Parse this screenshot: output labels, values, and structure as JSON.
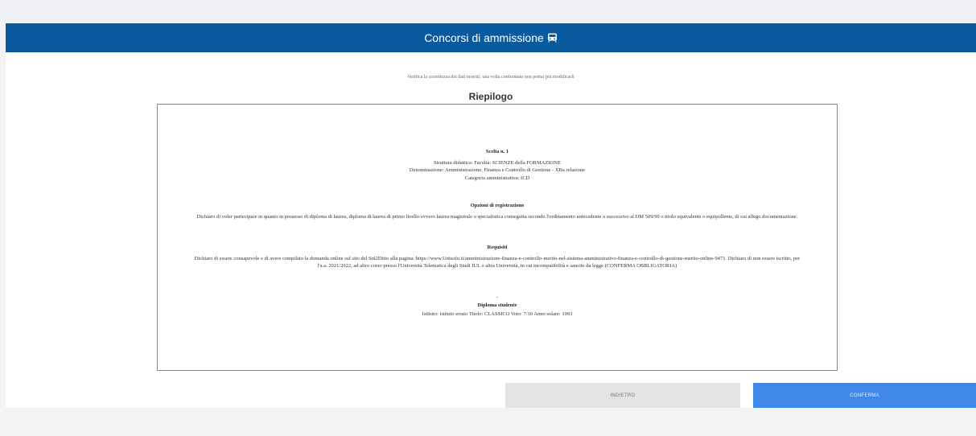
{
  "header": {
    "title": "Concorsi di ammissione",
    "icon": "train-icon"
  },
  "notice": "Verifica la correttezza dei dati inseriti, una volta confermato non potrai più modificarli",
  "summary_title": "Riepilogo",
  "sections": {
    "choice": {
      "heading": "Scelta n. 1",
      "lines": [
        "Struttura didattica: Facoltà: SCIENZE della FORMAZIONE",
        "Denominazione: Amministrazione, Finanza e Controllo di Gestione - XBa relazione",
        "Categoria amministrativa: ICD"
      ]
    },
    "options": {
      "heading": "Opzioni di registrazione",
      "text": "Dichiaro di voler partecipare in quanto in possesso di diploma di laurea, diploma di laurea di primo livello ovvero laurea magistrale o specialistica conseguita secondo l'ordinamento antecedente o successivo al DM 509/99 o titolo equivalente o equipollente, di cui allego documentazione."
    },
    "requirements": {
      "heading": "Requisiti",
      "text": "Dichiaro di essere consapevole e di avere compilato la domanda online sul sito del Sol2Ditto alla pagina: https://www.Unisofu.it/amministrazione-finanza-e-controllo-merito-nel-sistema-amministrativo-finanza-e-controllo-di-gestione-merito-online-9471. Dichiaro di non essere iscritto, per l'a.a. 2021/2022, ad altro corso presso l'Università Telematica degli Studi IUL o altra Università, in cui incompatibilità e sancite da legge (CONFERMA OBBLIGATORIA)"
    },
    "diploma": {
      "dash": "-",
      "heading": "Diploma studente",
      "line": "Istituto: istituto errato  Titolo: CLASSICO  Voto: 7/10  Anno solare: 1993"
    }
  },
  "buttons": {
    "back": "INDIETRO",
    "confirm": "CONFERMA"
  },
  "colors": {
    "header": "#0a5aa0",
    "confirm": "#3f87e8",
    "back": "#e3e3e3"
  }
}
